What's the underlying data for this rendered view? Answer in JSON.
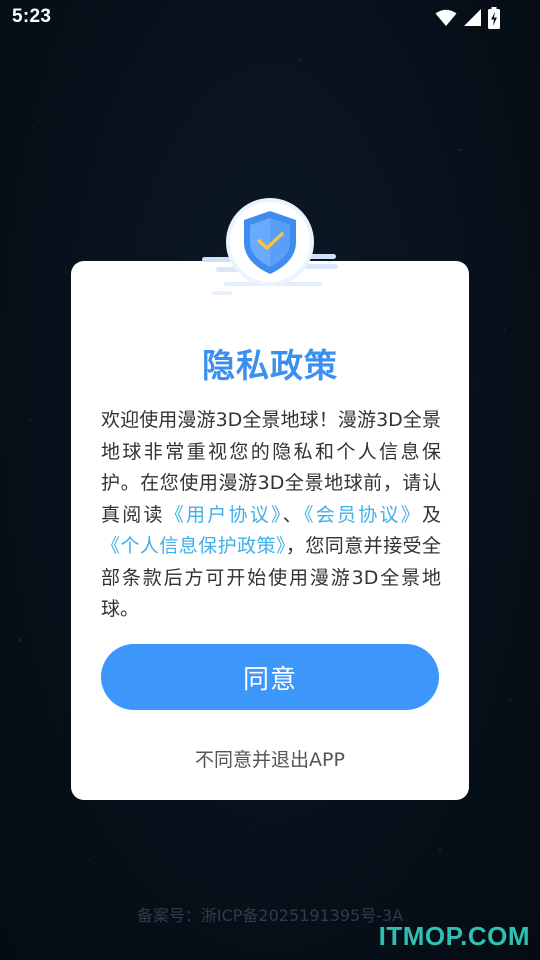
{
  "status_bar": {
    "time": "5:23",
    "icons": [
      "wifi-icon",
      "cellular-signal-icon",
      "battery-charging-icon"
    ]
  },
  "dialog": {
    "icon": "shield-check-icon",
    "title": "隐私政策",
    "body": {
      "intro": "欢迎使用漫游3D全景地球！漫游3D全景地球非常重视您的隐私和个人信息保护。在您使用漫游3D全景地球前，请认真阅读",
      "link_user_agreement": "《用户协议》",
      "separator": "、",
      "link_member_agreement": "《会员协议》",
      "and": "及",
      "link_privacy_policy": "《个人信息保护政策》",
      "outro": "，您同意并接受全部条款后方可开始使用漫游3D全景地球。"
    },
    "agree_label": "同意",
    "disagree_label": "不同意并退出APP"
  },
  "footer": {
    "icp": "备案号：浙ICP备2025191395号-3A"
  },
  "watermark": "ITMOP.COM",
  "colors": {
    "accent": "#3d97fb",
    "title": "#3a8ff0",
    "link": "#42b0e8",
    "background": "#07101a"
  }
}
